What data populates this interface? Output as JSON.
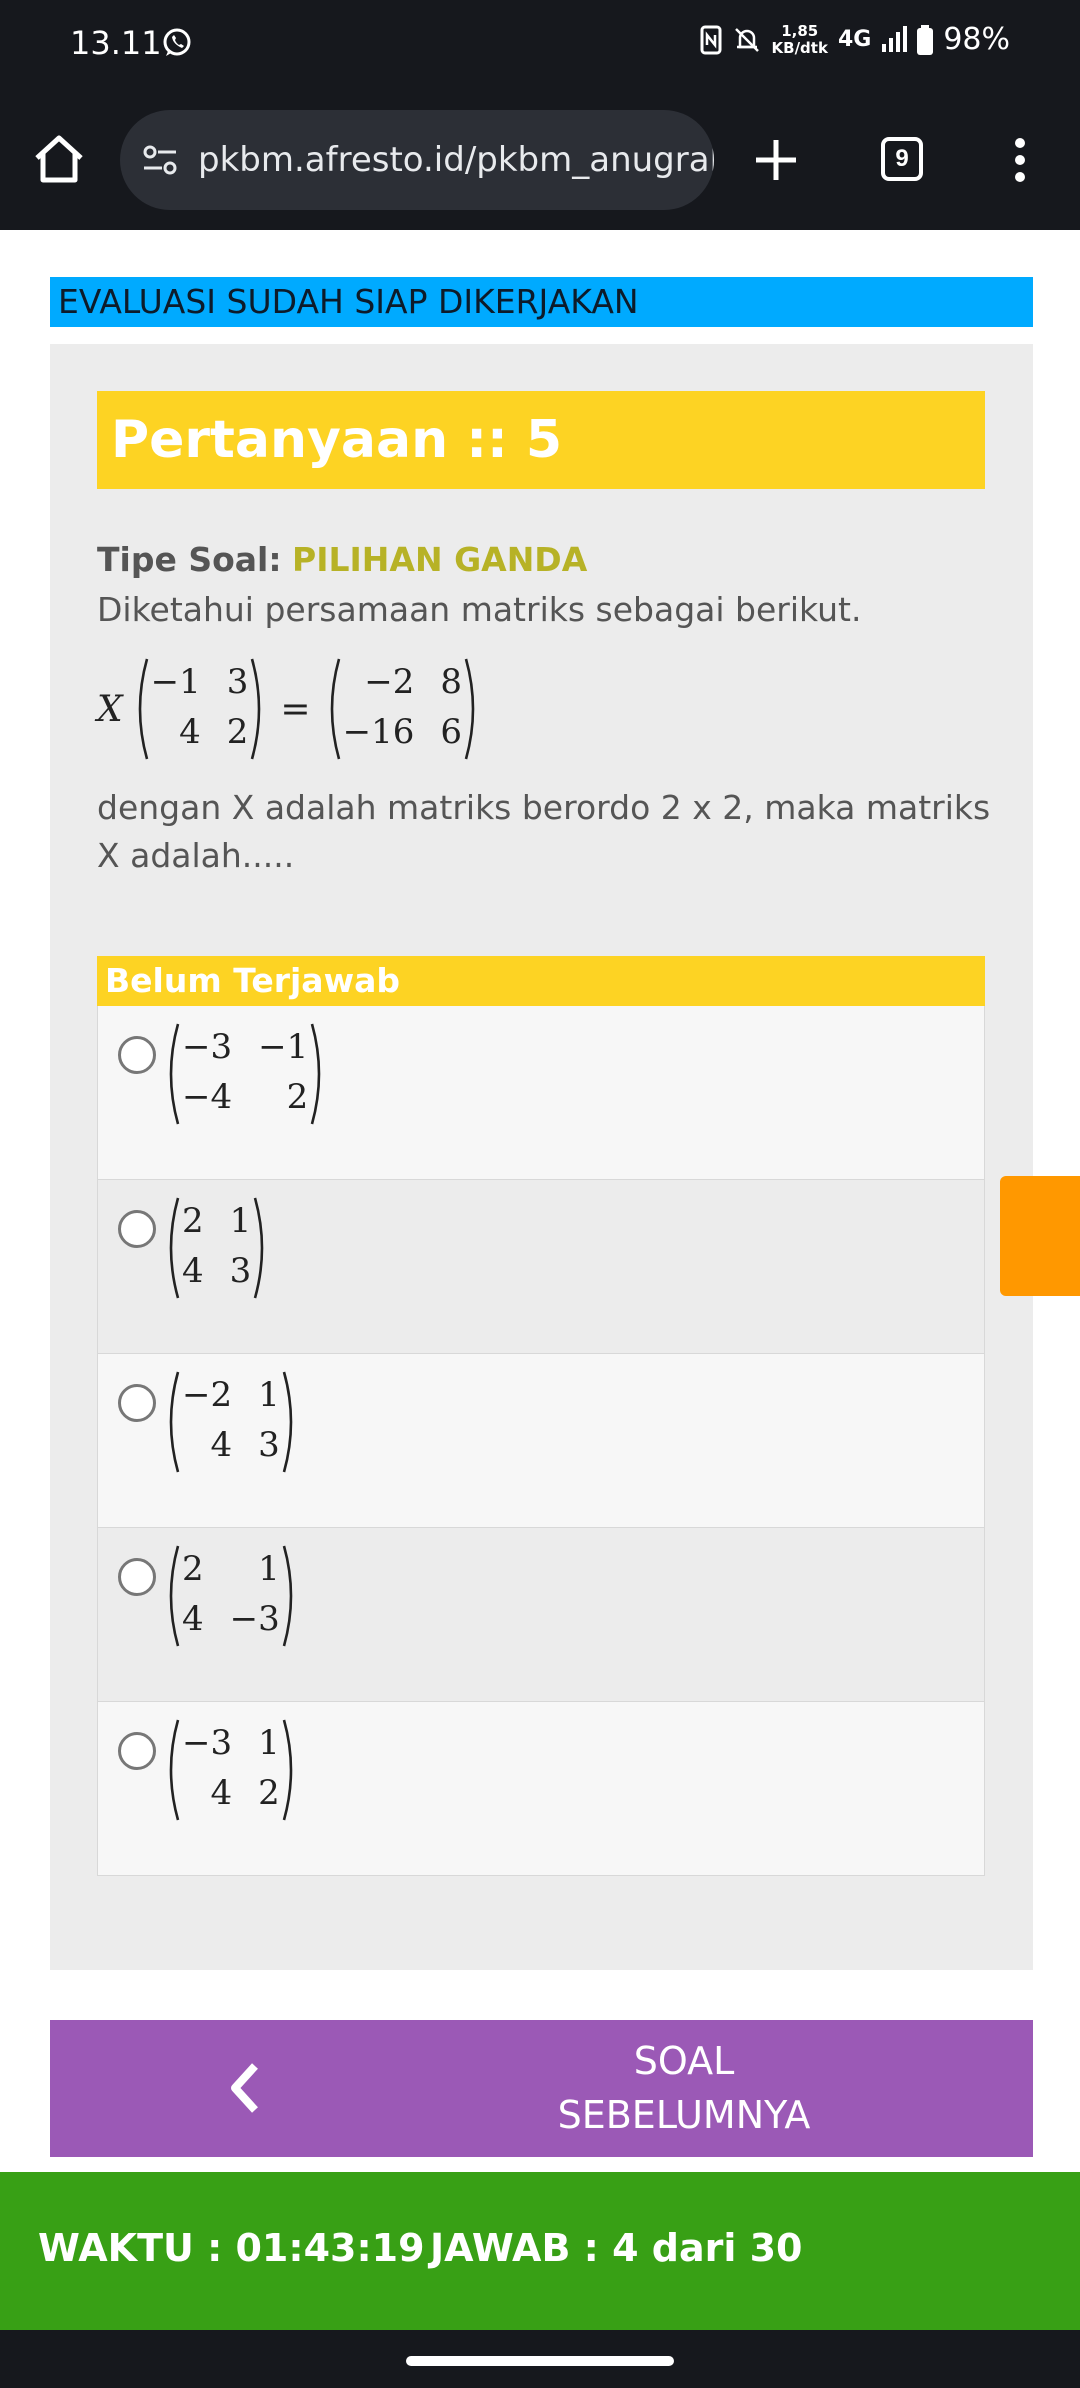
{
  "status_bar": {
    "time": "13.11",
    "speed_value": "1,85",
    "speed_unit": "KB/dtk",
    "network": "4G",
    "battery": "98%"
  },
  "browser": {
    "url": "pkbm.afresto.id/pkbm_anugrahb",
    "tab_count": "9"
  },
  "banner": "EVALUASI SUDAH SIAP DIKERJAKAN",
  "question": {
    "title": "Pertanyaan :: 5",
    "type_label": "Tipe Soal:",
    "type_value": "PILIHAN GANDA",
    "intro": "Diketahui persamaan matriks sebagai berikut.",
    "equation": {
      "variable": "X",
      "lhs_matrix": [
        "−1",
        "3",
        "4",
        "2"
      ],
      "equals": "=",
      "rhs_matrix": [
        "−2",
        "8",
        "−16",
        "6"
      ]
    },
    "text_after": "dengan X adalah matriks berordo 2 x 2, maka matriks X adalah....."
  },
  "answers": {
    "status": "Belum Terjawab",
    "options": [
      [
        "−3",
        "−1",
        "−4",
        "2"
      ],
      [
        "2",
        "1",
        "4",
        "3"
      ],
      [
        "−2",
        "1",
        "4",
        "3"
      ],
      [
        "2",
        "1",
        "4",
        "−3"
      ],
      [
        "−3",
        "1",
        "4",
        "2"
      ]
    ]
  },
  "nav": {
    "prev_line1": "SOAL",
    "prev_line2": "SEBELUMNYA"
  },
  "footer": {
    "waktu": "WAKTU : 01:43:19",
    "jawab": "JAWAB : 4 dari 30"
  },
  "colors": {
    "banner": "#00aaff",
    "header_yellow": "#fdd323",
    "type_value": "#b7b226",
    "prev_button": "#9b59b6",
    "footer": "#38a015",
    "side_tab": "#ff9800"
  }
}
